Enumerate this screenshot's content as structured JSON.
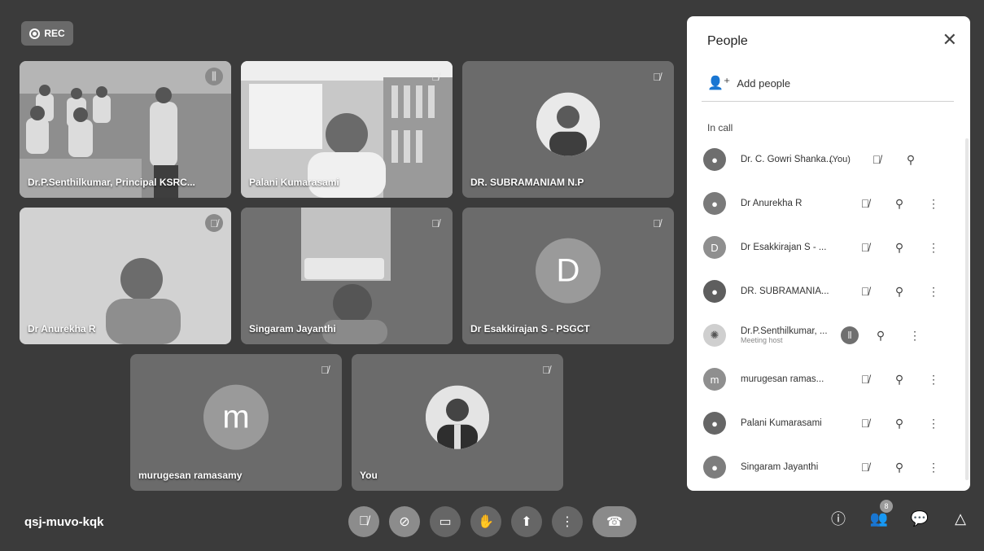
{
  "recording": {
    "label": "REC"
  },
  "tiles": [
    {
      "name": "Dr.P.Senthilkumar, Principal KSRC..."
    },
    {
      "name": "Palani Kumarasami"
    },
    {
      "name": "DR. SUBRAMANIAM N.P"
    },
    {
      "name": "Dr Anurekha R"
    },
    {
      "name": "Singaram Jayanthi"
    },
    {
      "name": "Dr Esakkirajan S - PSGCT",
      "avatar_letter": "D"
    },
    {
      "name": "murugesan ramasamy",
      "avatar_letter": "m"
    },
    {
      "name": "You"
    }
  ],
  "meeting": {
    "code": "qsj-muvo-kqk"
  },
  "controls": [
    "mic-off-icon",
    "camera-off-icon",
    "captions-icon",
    "raise-hand-icon",
    "present-icon",
    "more-icon",
    "hang-up-icon"
  ],
  "right_icons": {
    "people_count": "8"
  },
  "people_panel": {
    "title": "People",
    "add_people": "Add people",
    "section": "In call",
    "participants": [
      {
        "name": "Dr. C. Gowri Shanka...",
        "tag": "(You)",
        "avatar": "photo"
      },
      {
        "name": "Dr Anurekha R",
        "avatar": "photo"
      },
      {
        "name": "Dr Esakkirajan S - ...",
        "avatar_letter": "D"
      },
      {
        "name": "DR. SUBRAMANIA...",
        "avatar": "photo"
      },
      {
        "name": "Dr.P.Senthilkumar, ...",
        "sub": "Meeting host",
        "avatar": "logo"
      },
      {
        "name": "murugesan ramas...",
        "avatar_letter": "m"
      },
      {
        "name": "Palani Kumarasami",
        "avatar": "photo"
      },
      {
        "name": "Singaram Jayanthi",
        "avatar": "photo"
      }
    ]
  },
  "colors": {
    "stage": "#3b3b3b",
    "tile": "#6b6b6b",
    "panel": "#ffffff"
  }
}
